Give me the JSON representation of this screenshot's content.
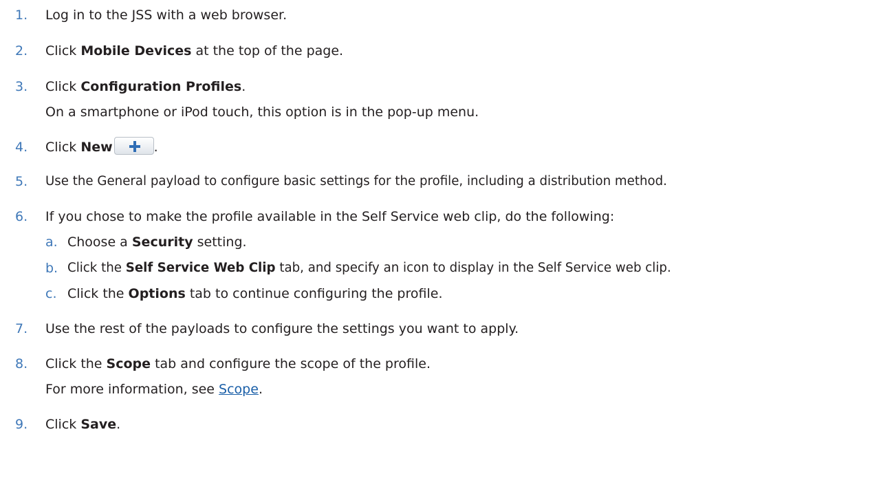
{
  "steps": [
    {
      "num": "1.",
      "parts": [
        "Log in to the JSS with a web browser."
      ]
    },
    {
      "num": "2.",
      "parts": [
        "Click ",
        "Mobile Devices",
        " at the top of the page."
      ]
    },
    {
      "num": "3.",
      "parts": [
        "Click ",
        "Configuration Profiles",
        "."
      ],
      "note": "On a smartphone or iPod touch, this option is in the pop-up menu."
    },
    {
      "num": "4.",
      "parts": [
        "Click ",
        "New",
        "."
      ]
    },
    {
      "num": "5.",
      "parts": [
        "Use the General payload to configure basic settings for the profile, including a distribution method."
      ]
    },
    {
      "num": "6.",
      "parts": [
        "If you chose to make the profile available in the Self Service web clip, do the following:"
      ],
      "substeps": [
        {
          "num": "a.",
          "parts": [
            "Choose a ",
            "Security",
            " setting."
          ]
        },
        {
          "num": "b.",
          "parts": [
            "Click the ",
            "Self Service Web Clip",
            " tab, and specify an icon to display in the Self Service web clip."
          ]
        },
        {
          "num": "c.",
          "parts": [
            "Click the ",
            "Options",
            " tab to continue configuring the profile."
          ]
        }
      ]
    },
    {
      "num": "7.",
      "parts": [
        "Use the rest of the payloads to configure the settings you want to apply."
      ]
    },
    {
      "num": "8.",
      "parts": [
        "Click the ",
        "Scope",
        " tab and configure the scope of the profile."
      ],
      "note_parts": [
        "For more information, see ",
        "Scope",
        "."
      ]
    },
    {
      "num": "9.",
      "parts": [
        "Click ",
        "Save",
        "."
      ]
    }
  ]
}
